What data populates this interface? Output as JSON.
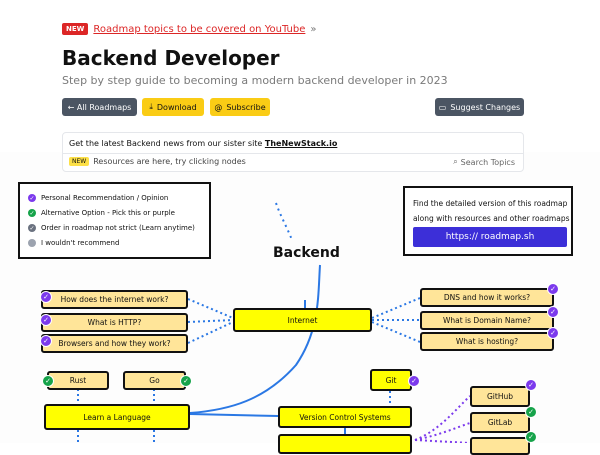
{
  "banner": {
    "tag": "NEW",
    "link": "Roadmap topics to be covered on YouTube",
    "arrow": "»"
  },
  "header": {
    "title": "Backend Developer",
    "subtitle": "Step by step guide to becoming a modern backend developer in 2023"
  },
  "buttons": {
    "all_roadmaps": "← All Roadmaps",
    "download": "Download",
    "subscribe": "Subscribe",
    "suggest": "Suggest Changes"
  },
  "icons": {
    "download": "download-icon",
    "subscribe": "at-sign-icon",
    "suggest": "chat-bubble-icon",
    "search": "search-icon"
  },
  "news": {
    "text": "Get the latest Backend news from our sister site",
    "site": "TheNewStack.io",
    "new_tag": "NEW",
    "resources": "Resources are here, try clicking nodes",
    "search": "Search Topics"
  },
  "legend": [
    {
      "label": "Personal Recommendation / Opinion",
      "color": "#7c3aed",
      "mark": "✓"
    },
    {
      "label": "Alternative Option - Pick this or purple",
      "color": "#16a34a",
      "mark": "✓"
    },
    {
      "label": "Order in roadmap not strict (Learn anytime)",
      "color": "#6b7280",
      "mark": "✓"
    },
    {
      "label": "I wouldn't recommend",
      "color": "#9ca3af",
      "mark": ""
    }
  ],
  "infobox": {
    "line1": "Find the detailed version of this roadmap",
    "line2": "along with resources and other roadmaps",
    "link": "https:// roadmap.sh"
  },
  "roadmap": {
    "root": "Backend",
    "nodes": {
      "internet": "Internet",
      "how_internet": "How does the internet work?",
      "http": "What is HTTP?",
      "browsers": "Browsers and how they work?",
      "dns": "DNS and how it works?",
      "domain": "What is Domain Name?",
      "hosting": "What is hosting?",
      "rust": "Rust",
      "go": "Go",
      "learn_language": "Learn a Language",
      "git": "Git",
      "vcs": "Version Control Systems",
      "github": "GitHub",
      "gitlab": "GitLab"
    }
  },
  "colors": {
    "accent": "#facc15",
    "link_button": "#3c2fd8",
    "purple": "#7c3aed",
    "green": "#16a34a",
    "new_red": "#dc2626"
  }
}
